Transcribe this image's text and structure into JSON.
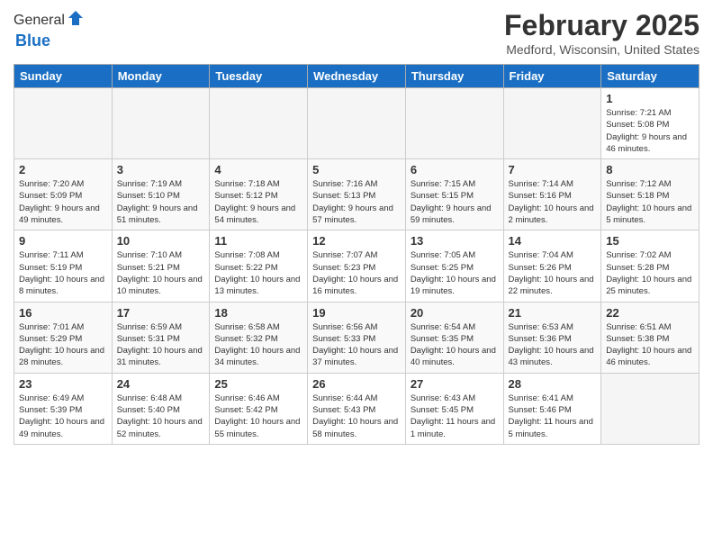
{
  "header": {
    "logo_general": "General",
    "logo_blue": "Blue",
    "month_title": "February 2025",
    "location": "Medford, Wisconsin, United States"
  },
  "days_of_week": [
    "Sunday",
    "Monday",
    "Tuesday",
    "Wednesday",
    "Thursday",
    "Friday",
    "Saturday"
  ],
  "weeks": [
    [
      {
        "day": "",
        "info": "",
        "empty": true
      },
      {
        "day": "",
        "info": "",
        "empty": true
      },
      {
        "day": "",
        "info": "",
        "empty": true
      },
      {
        "day": "",
        "info": "",
        "empty": true
      },
      {
        "day": "",
        "info": "",
        "empty": true
      },
      {
        "day": "",
        "info": "",
        "empty": true
      },
      {
        "day": "1",
        "info": "Sunrise: 7:21 AM\nSunset: 5:08 PM\nDaylight: 9 hours and 46 minutes."
      }
    ],
    [
      {
        "day": "2",
        "info": "Sunrise: 7:20 AM\nSunset: 5:09 PM\nDaylight: 9 hours and 49 minutes."
      },
      {
        "day": "3",
        "info": "Sunrise: 7:19 AM\nSunset: 5:10 PM\nDaylight: 9 hours and 51 minutes."
      },
      {
        "day": "4",
        "info": "Sunrise: 7:18 AM\nSunset: 5:12 PM\nDaylight: 9 hours and 54 minutes."
      },
      {
        "day": "5",
        "info": "Sunrise: 7:16 AM\nSunset: 5:13 PM\nDaylight: 9 hours and 57 minutes."
      },
      {
        "day": "6",
        "info": "Sunrise: 7:15 AM\nSunset: 5:15 PM\nDaylight: 9 hours and 59 minutes."
      },
      {
        "day": "7",
        "info": "Sunrise: 7:14 AM\nSunset: 5:16 PM\nDaylight: 10 hours and 2 minutes."
      },
      {
        "day": "8",
        "info": "Sunrise: 7:12 AM\nSunset: 5:18 PM\nDaylight: 10 hours and 5 minutes."
      }
    ],
    [
      {
        "day": "9",
        "info": "Sunrise: 7:11 AM\nSunset: 5:19 PM\nDaylight: 10 hours and 8 minutes."
      },
      {
        "day": "10",
        "info": "Sunrise: 7:10 AM\nSunset: 5:21 PM\nDaylight: 10 hours and 10 minutes."
      },
      {
        "day": "11",
        "info": "Sunrise: 7:08 AM\nSunset: 5:22 PM\nDaylight: 10 hours and 13 minutes."
      },
      {
        "day": "12",
        "info": "Sunrise: 7:07 AM\nSunset: 5:23 PM\nDaylight: 10 hours and 16 minutes."
      },
      {
        "day": "13",
        "info": "Sunrise: 7:05 AM\nSunset: 5:25 PM\nDaylight: 10 hours and 19 minutes."
      },
      {
        "day": "14",
        "info": "Sunrise: 7:04 AM\nSunset: 5:26 PM\nDaylight: 10 hours and 22 minutes."
      },
      {
        "day": "15",
        "info": "Sunrise: 7:02 AM\nSunset: 5:28 PM\nDaylight: 10 hours and 25 minutes."
      }
    ],
    [
      {
        "day": "16",
        "info": "Sunrise: 7:01 AM\nSunset: 5:29 PM\nDaylight: 10 hours and 28 minutes."
      },
      {
        "day": "17",
        "info": "Sunrise: 6:59 AM\nSunset: 5:31 PM\nDaylight: 10 hours and 31 minutes."
      },
      {
        "day": "18",
        "info": "Sunrise: 6:58 AM\nSunset: 5:32 PM\nDaylight: 10 hours and 34 minutes."
      },
      {
        "day": "19",
        "info": "Sunrise: 6:56 AM\nSunset: 5:33 PM\nDaylight: 10 hours and 37 minutes."
      },
      {
        "day": "20",
        "info": "Sunrise: 6:54 AM\nSunset: 5:35 PM\nDaylight: 10 hours and 40 minutes."
      },
      {
        "day": "21",
        "info": "Sunrise: 6:53 AM\nSunset: 5:36 PM\nDaylight: 10 hours and 43 minutes."
      },
      {
        "day": "22",
        "info": "Sunrise: 6:51 AM\nSunset: 5:38 PM\nDaylight: 10 hours and 46 minutes."
      }
    ],
    [
      {
        "day": "23",
        "info": "Sunrise: 6:49 AM\nSunset: 5:39 PM\nDaylight: 10 hours and 49 minutes."
      },
      {
        "day": "24",
        "info": "Sunrise: 6:48 AM\nSunset: 5:40 PM\nDaylight: 10 hours and 52 minutes."
      },
      {
        "day": "25",
        "info": "Sunrise: 6:46 AM\nSunset: 5:42 PM\nDaylight: 10 hours and 55 minutes."
      },
      {
        "day": "26",
        "info": "Sunrise: 6:44 AM\nSunset: 5:43 PM\nDaylight: 10 hours and 58 minutes."
      },
      {
        "day": "27",
        "info": "Sunrise: 6:43 AM\nSunset: 5:45 PM\nDaylight: 11 hours and 1 minute."
      },
      {
        "day": "28",
        "info": "Sunrise: 6:41 AM\nSunset: 5:46 PM\nDaylight: 11 hours and 5 minutes."
      },
      {
        "day": "",
        "info": "",
        "empty": true
      }
    ]
  ]
}
